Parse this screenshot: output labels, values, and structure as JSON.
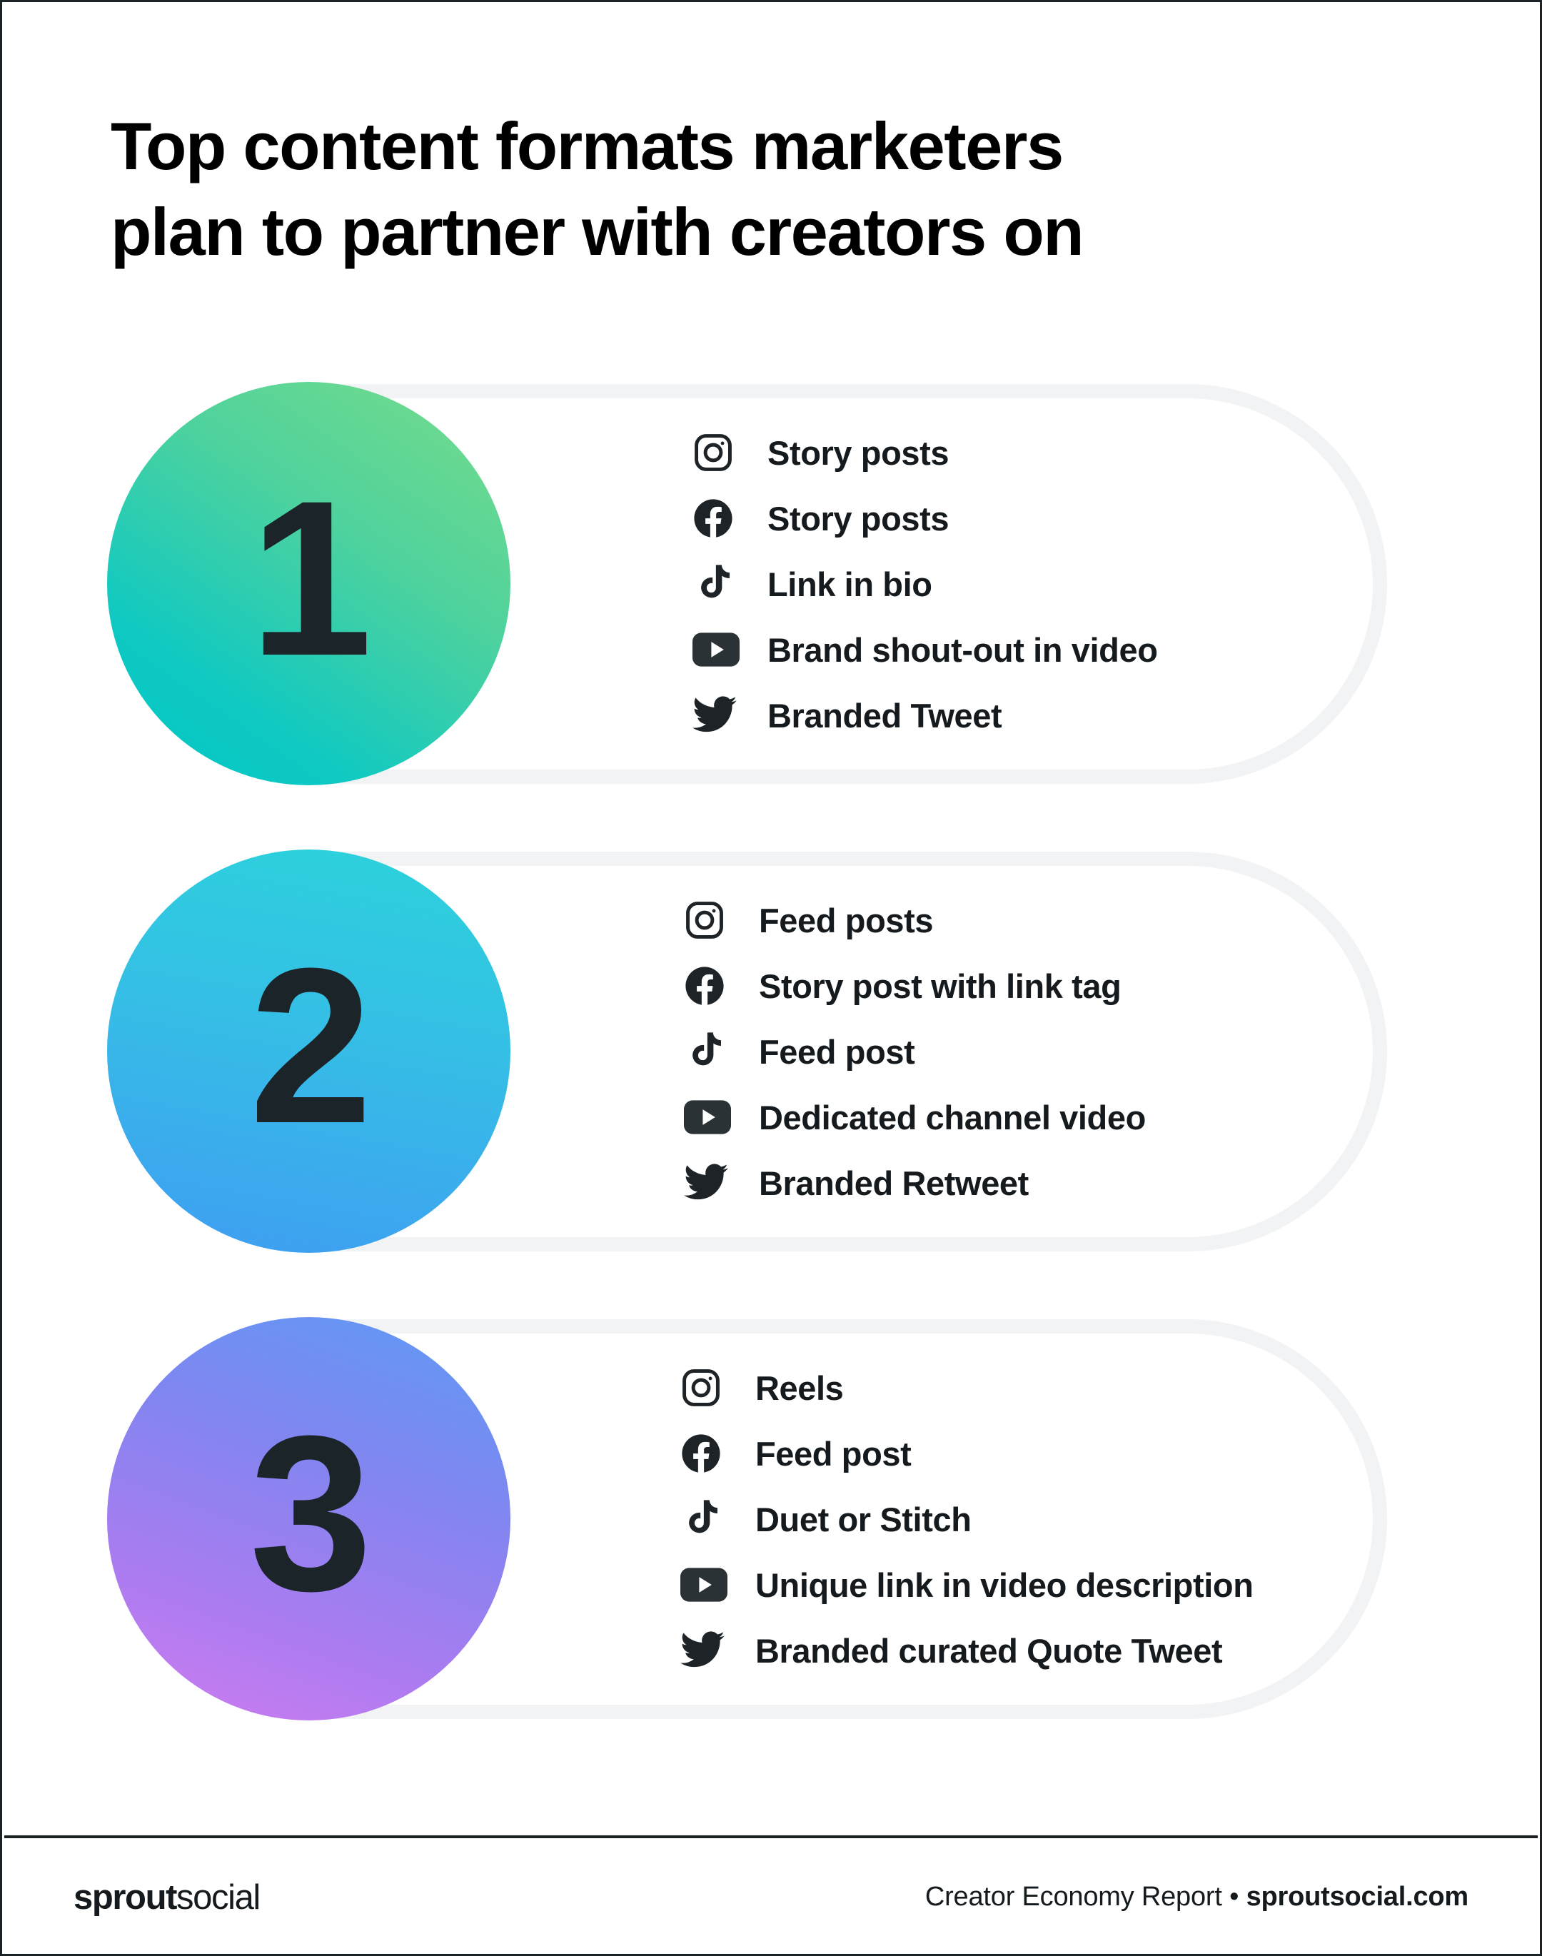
{
  "page": {
    "title": "Top content formats marketers\nplan to partner with creators on",
    "background_color": "#FFFFFF",
    "border_color": "#1A2226"
  },
  "cards": [
    {
      "rank": "1",
      "gradient": {
        "from": "#79DD8A",
        "to": "#00C6C6"
      },
      "items": [
        {
          "icon": "instagram-icon",
          "label": "Story posts"
        },
        {
          "icon": "facebook-icon",
          "label": "Story posts"
        },
        {
          "icon": "tiktok-icon",
          "label": "Link in bio"
        },
        {
          "icon": "youtube-icon",
          "label": "Brand shout-out in video"
        },
        {
          "icon": "twitter-icon",
          "label": "Branded Tweet"
        }
      ]
    },
    {
      "rank": "2",
      "gradient": {
        "from": "#2BD3DA",
        "to": "#3F9DF2"
      },
      "items": [
        {
          "icon": "instagram-icon",
          "label": "Feed posts"
        },
        {
          "icon": "facebook-icon",
          "label": "Story post with link tag"
        },
        {
          "icon": "tiktok-icon",
          "label": "Feed post"
        },
        {
          "icon": "youtube-icon",
          "label": "Dedicated channel video"
        },
        {
          "icon": "twitter-icon",
          "label": "Branded Retweet"
        }
      ]
    },
    {
      "rank": "3",
      "gradient": {
        "from": "#5C9BF5",
        "to": "#CF7CEF"
      },
      "items": [
        {
          "icon": "instagram-icon",
          "label": "Reels"
        },
        {
          "icon": "facebook-icon",
          "label": "Feed post"
        },
        {
          "icon": "tiktok-icon",
          "label": "Duet or Stitch"
        },
        {
          "icon": "youtube-icon",
          "label": "Unique link in video description"
        },
        {
          "icon": "twitter-icon",
          "label": "Branded curated Quote Tweet"
        }
      ]
    }
  ],
  "footer": {
    "logo_bold": "sprout",
    "logo_light": "social",
    "meta_text": "Creator Economy Report • ",
    "meta_site": "sproutsocial.com"
  }
}
